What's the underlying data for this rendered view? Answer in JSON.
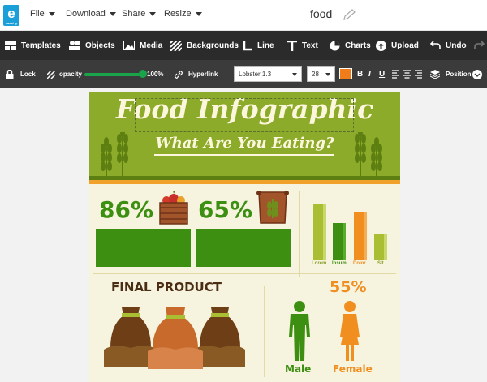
{
  "app": {
    "logo_letter": "e",
    "logo_caption": "easel.ly",
    "doc_title": "food"
  },
  "menu": [
    {
      "label": "File"
    },
    {
      "label": "Download"
    },
    {
      "label": "Share"
    },
    {
      "label": "Resize"
    }
  ],
  "toolbar": {
    "templates": "Templates",
    "objects": "Objects",
    "media": "Media",
    "backgrounds": "Backgrounds",
    "line": "Line",
    "text": "Text",
    "charts": "Charts",
    "upload": "Upload",
    "undo": "Undo"
  },
  "format": {
    "lock": "Lock",
    "opacity_label": "opacity",
    "opacity_value": "100%",
    "opacity_fraction": 1.0,
    "hyperlink": "Hyperlink",
    "font": "Lobster 1.3",
    "size": "28",
    "color": "#f07d1a",
    "bold": "B",
    "italic": "I",
    "underline": "U",
    "position": "Position"
  },
  "infographic": {
    "title": "Food Infographic",
    "subtitle": "What Are You Eating?",
    "stat1": "86%",
    "stat2": "65%",
    "bar_labels": [
      "Lorem",
      "Ipsum",
      "Dolor",
      "Sit"
    ],
    "final_product": "FINAL PRODUCT",
    "stat3": "55%",
    "male": "Male",
    "female": "Female"
  },
  "colors": {
    "toolbar_bg": "#2b2b2b",
    "format_bg": "#3b3b3b",
    "header_green": "#8dab2a",
    "stat_green": "#3d8f12",
    "accent_orange": "#f08e1f",
    "brown": "#4a2d12",
    "cream": "#f6f3df"
  }
}
